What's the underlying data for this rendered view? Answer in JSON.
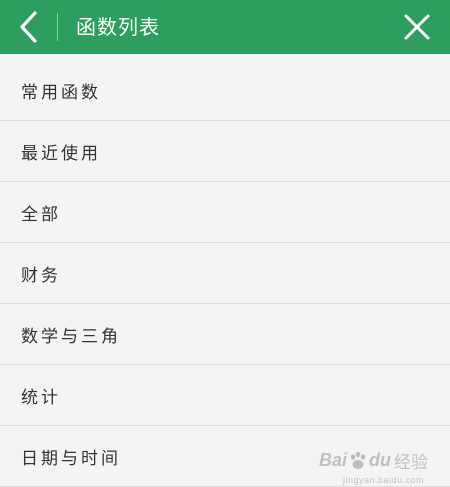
{
  "header": {
    "title": "函数列表",
    "back_icon": "chevron-left-icon",
    "close_icon": "close-icon",
    "background": "#2e9e5f"
  },
  "list": {
    "items": [
      {
        "label": "常用函数"
      },
      {
        "label": "最近使用"
      },
      {
        "label": "全部"
      },
      {
        "label": "财务"
      },
      {
        "label": "数学与三角"
      },
      {
        "label": "统计"
      },
      {
        "label": "日期与时间"
      }
    ]
  },
  "watermark": {
    "brand_a": "Bai",
    "brand_b": "du",
    "suffix": "经验",
    "url": "jingyan.baidu.com"
  }
}
